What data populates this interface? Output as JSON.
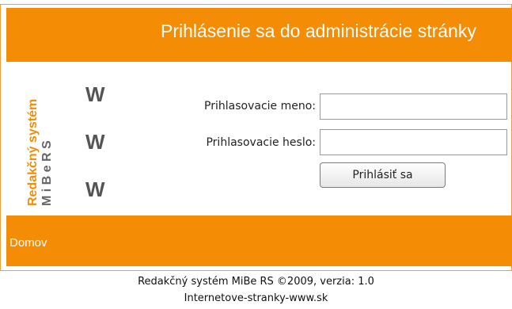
{
  "header": {
    "title": "Prihlásenie sa do administrácie stránky"
  },
  "brand": {
    "line1": "Redakčný systém",
    "line2": "M i B e   R S",
    "colors": {
      "orange": "#f48c06",
      "gray": "#666666"
    }
  },
  "watermark": {
    "letters": [
      "W",
      "W",
      "W"
    ]
  },
  "form": {
    "username_label": "Prihlasovacie meno:",
    "username_value": "",
    "password_label": "Prihlasovacie heslo:",
    "password_value": "",
    "submit_label": "Prihlásiť sa"
  },
  "nav": {
    "home_label": "Domov"
  },
  "footer": {
    "credit": "Redakčný systém MiBe RS ©2009, verzia: 1.0",
    "site": "Internetove-stranky-www.sk"
  },
  "colors": {
    "accent": "#f48c06",
    "border": "#f39c3a"
  }
}
